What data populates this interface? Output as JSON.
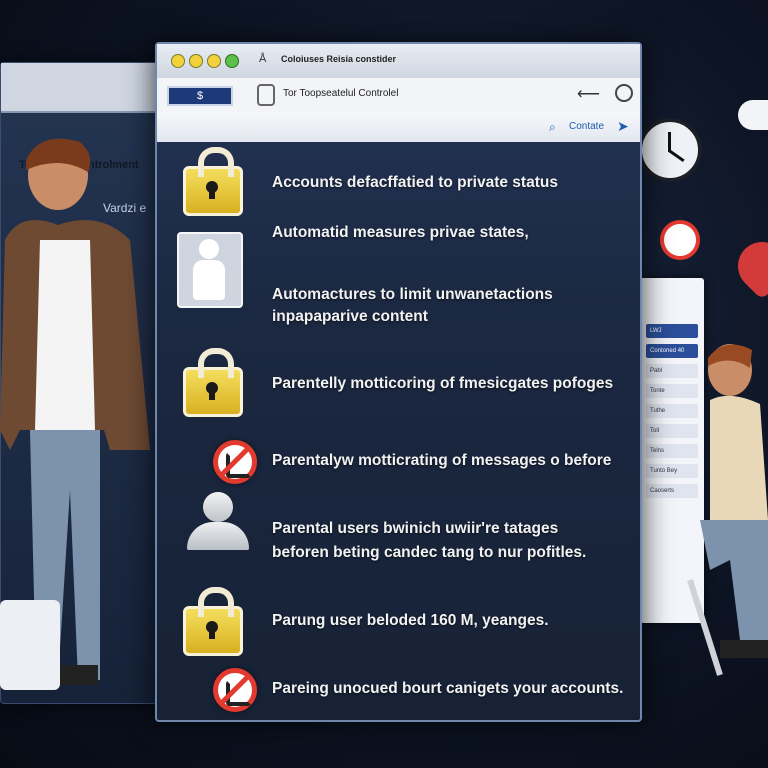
{
  "background": {
    "left_window": {
      "title": "Toosoceu Controlment",
      "subtitle": "Vardzi e"
    },
    "right_window": {
      "rows": [
        "LWJ",
        "Contoned 40",
        "Pabl",
        "Tonte",
        "Tuthe",
        "Toll",
        "Telns",
        "Tunto Bey",
        "Caoserts"
      ]
    }
  },
  "main_window": {
    "tab_title": "Coloiuses Reisia constider",
    "address": {
      "button_label": "$",
      "url": "Tor Toopseatelul Controlel"
    },
    "subbar": {
      "link_label": "Contate"
    },
    "items": [
      {
        "icon": "lock-icon",
        "text": "Accounts   defacffatied to private status"
      },
      {
        "icon": "person-icon",
        "text": "Automatid measures   privae states,"
      },
      {
        "icon": "none",
        "text": "Automactures to limit unwanetactions",
        "text2": "inpapaparive content"
      },
      {
        "icon": "lock-icon",
        "text": "Parentelly motticoring of fmesicgates pofoges"
      },
      {
        "icon": "no-sign-icon",
        "text": "Parentalyw motticrating of messages o before"
      },
      {
        "icon": "user-icon",
        "text": "Parental users bwinich uwiir're tatages",
        "text2": "beforen beting candec tang to  nur pofitles."
      },
      {
        "icon": "lock-icon",
        "text": "Parung user beloded 160 M, yeanges."
      },
      {
        "icon": "no-sign-icon",
        "text": "Pareing unocued bourt canigets your accounts."
      }
    ]
  },
  "colors": {
    "window_bg": "#1b2841",
    "lock_yellow": "#e6c233",
    "no_sign_red": "#e23a2e",
    "accent_blue": "#1f5bb0"
  }
}
